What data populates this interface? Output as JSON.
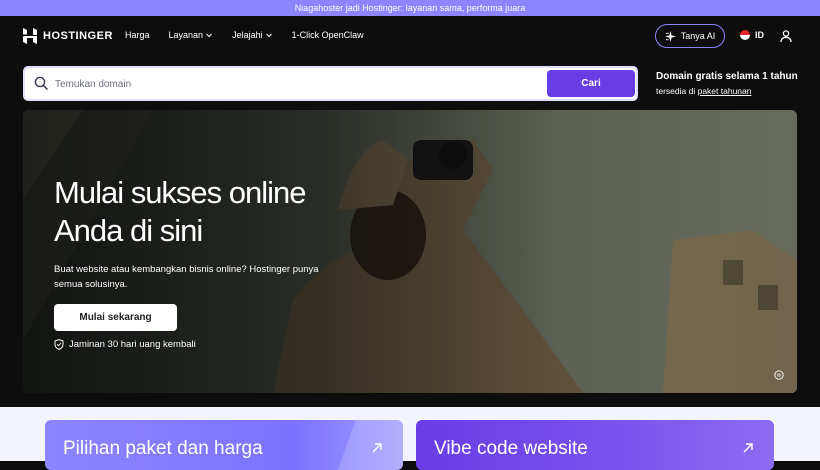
{
  "announcement": "Niagahoster jadi Hostinger: layanan sama, performa juara",
  "brand": {
    "name": "HOSTINGER"
  },
  "nav": {
    "items": [
      {
        "label": "Harga",
        "dropdown": false
      },
      {
        "label": "Layanan",
        "dropdown": true
      },
      {
        "label": "Jelajahi",
        "dropdown": true
      },
      {
        "label": "1-Click OpenClaw",
        "dropdown": false
      }
    ],
    "ask_ai": "Tanya AI",
    "language": "ID"
  },
  "search": {
    "placeholder": "Temukan domain",
    "button": "Cari"
  },
  "promo": {
    "title": "Domain gratis selama 1 tahun",
    "sub_prefix": "tersedia di ",
    "sub_link": "paket tahunan"
  },
  "hero": {
    "title_line1": "Mulai sukses online",
    "title_line2": "Anda di sini",
    "subtitle": "Buat website atau kembangkan bisnis online? Hostinger punya semua solusinya.",
    "cta": "Mulai sekarang",
    "guarantee": "Jaminan 30 hari uang kembali"
  },
  "cards": [
    {
      "title": "Pilihan paket dan harga"
    },
    {
      "title": "Vibe code website"
    }
  ],
  "colors": {
    "brand_purple": "#673de6",
    "accent_lavender": "#8c85ff",
    "background": "#0d0d0d"
  }
}
